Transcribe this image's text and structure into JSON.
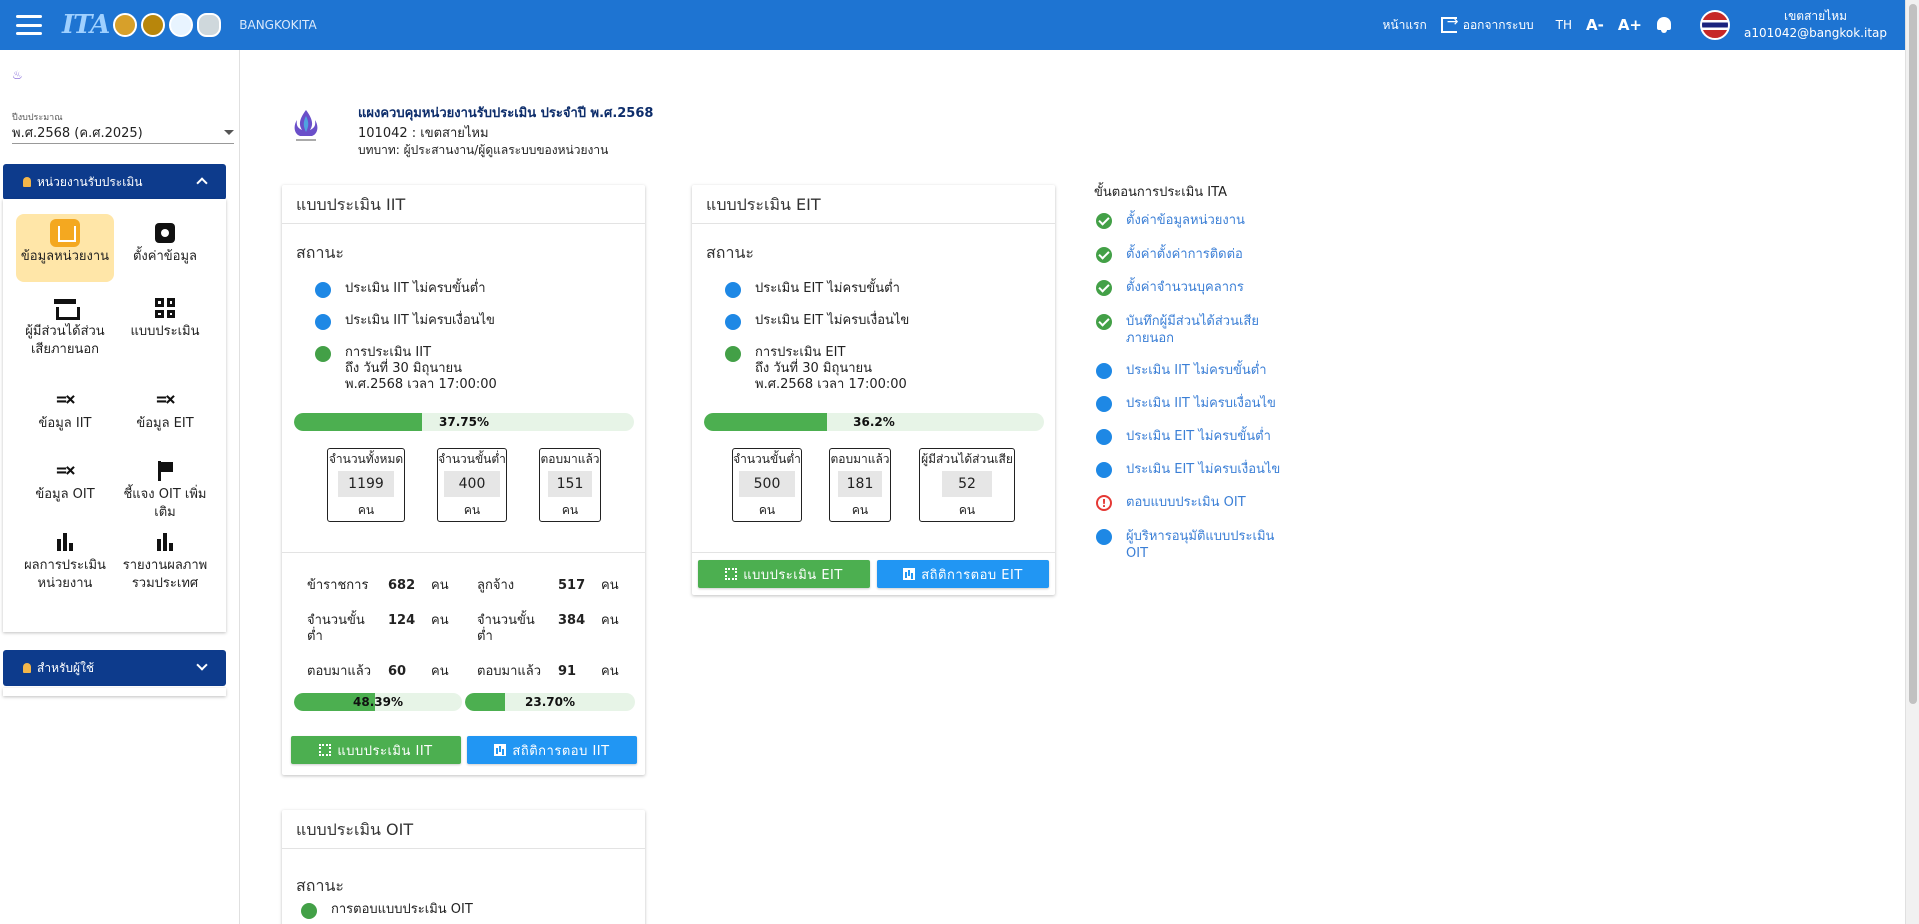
{
  "topbar": {
    "brand": "BANGKOKITA",
    "logo_text": "ITA",
    "home_link": "หน้าแรก",
    "logout_link": "ออกจากระบบ",
    "lang": "TH",
    "font_decrease": "A-",
    "font_increase": "A+",
    "user_name": "เขตสายไหม",
    "user_email": "a101042@bangkok.itap"
  },
  "sidebar": {
    "year_label": "ปีงบประมาณ",
    "year_value": "พ.ศ.2568 (ค.ศ.2025)",
    "panel1_title": "หน่วยงานรับประเมิน",
    "panel2_title": "สำหรับผู้ใช้",
    "items": [
      {
        "label": "ข้อมูลหน่วยงาน"
      },
      {
        "label": "ตั้งค่าข้อมูล"
      },
      {
        "label": "ผู้มีส่วนได้ส่วนเสียภายนอก"
      },
      {
        "label": "แบบประเมิน"
      },
      {
        "label": "ข้อมูล IIT"
      },
      {
        "label": "ข้อมูล EIT"
      },
      {
        "label": "ข้อมูล OIT"
      },
      {
        "label": "ชี้แจง OIT เพิ่มเติม"
      },
      {
        "label": "ผลการประเมินหน่วยงาน"
      },
      {
        "label": "รายงานผลภาพรวมประเทศ"
      }
    ]
  },
  "header": {
    "title": "แผงควบคุมหน่วยงานรับประเมิน ประจำปี พ.ศ.2568",
    "code": "101042 : เขตสายไหม",
    "role": "บทบาท: ผู้ประสานงาน/ผู้ดูแลระบบของหน่วยงาน"
  },
  "iit": {
    "title": "แบบประเมิน IIT",
    "status_label": "สถานะ",
    "status": [
      "ประเมิน IIT ไม่ครบขั้นต่ำ",
      "ประเมิน IIT ไม่ครบเงื่อนไข"
    ],
    "deadline_title": "การประเมิน IIT",
    "deadline_line1": "ถึง วันที่ 30 มิถุนายน",
    "deadline_line2": "พ.ศ.2568 เวลา 17:00:00",
    "progress": 37.75,
    "progress_label": "37.75%",
    "boxes": [
      {
        "label": "จำนวนทั้งหมด",
        "value": "1199",
        "unit": "คน"
      },
      {
        "label": "จำนวนขั้นต่ำ",
        "value": "400",
        "unit": "คน"
      },
      {
        "label": "ตอบมาแล้ว",
        "value": "151",
        "unit": "คน"
      }
    ],
    "detail": {
      "civil_label": "ข้าราชการ",
      "civil_value": "682",
      "employee_label": "ลูกจ้าง",
      "employee_value": "517",
      "min_label": "จำนวนขั้นต่ำ",
      "civil_min": "124",
      "employee_min": "384",
      "answered_label": "ตอบมาแล้ว",
      "civil_answered": "60",
      "employee_answered": "91",
      "unit": "คน",
      "civil_progress": 48.39,
      "civil_progress_label": "48.39%",
      "employee_progress": 23.7,
      "employee_progress_label": "23.70%"
    },
    "btn_form": "แบบประเมิน IIT",
    "btn_stats": "สถิติการตอบ IIT"
  },
  "eit": {
    "title": "แบบประเมิน EIT",
    "status_label": "สถานะ",
    "status": [
      "ประเมิน EIT ไม่ครบขั้นต่ำ",
      "ประเมิน EIT ไม่ครบเงื่อนไข"
    ],
    "deadline_title": "การประเมิน EIT",
    "deadline_line1": "ถึง วันที่ 30 มิถุนายน",
    "deadline_line2": "พ.ศ.2568 เวลา 17:00:00",
    "progress": 36.2,
    "progress_label": "36.2%",
    "boxes": [
      {
        "label": "จำนวนขั้นต่ำ",
        "value": "500",
        "unit": "คน"
      },
      {
        "label": "ตอบมาแล้ว",
        "value": "181",
        "unit": "คน"
      },
      {
        "label": "ผู้มีส่วนได้ส่วนเสีย",
        "value": "52",
        "unit": "คน"
      }
    ],
    "btn_form": "แบบประเมิน EIT",
    "btn_stats": "สถิติการตอบ EIT"
  },
  "oit": {
    "title": "แบบประเมิน OIT",
    "status_label": "สถานะ",
    "status_first": "การตอบแบบประเมิน OIT"
  },
  "steps": {
    "title": "ขั้นตอนการประเมิน ITA",
    "items": [
      {
        "label": "ตั้งค่าข้อมูลหน่วยงาน",
        "state": "done"
      },
      {
        "label": "ตั้งค่าตั้งค่าการติดต่อ",
        "state": "done"
      },
      {
        "label": "ตั้งค่าจำนวนบุคลากร",
        "state": "done"
      },
      {
        "label": "บันทึกผู้มีส่วนได้ส่วนเสีย",
        "label2": "ภายนอก",
        "state": "done"
      },
      {
        "label": "ประเมิน IIT ไม่ครบขั้นต่ำ",
        "state": "pending"
      },
      {
        "label": "ประเมิน IIT ไม่ครบเงื่อนไข",
        "state": "pending"
      },
      {
        "label": "ประเมิน EIT ไม่ครบขั้นต่ำ",
        "state": "pending"
      },
      {
        "label": "ประเมิน EIT ไม่ครบเงื่อนไข",
        "state": "pending"
      },
      {
        "label": "ตอบแบบประเมิน OIT",
        "state": "warning"
      },
      {
        "label": "ผู้บริหารอนุมัติแบบประเมิน",
        "label2": "OIT",
        "state": "pending"
      }
    ]
  }
}
